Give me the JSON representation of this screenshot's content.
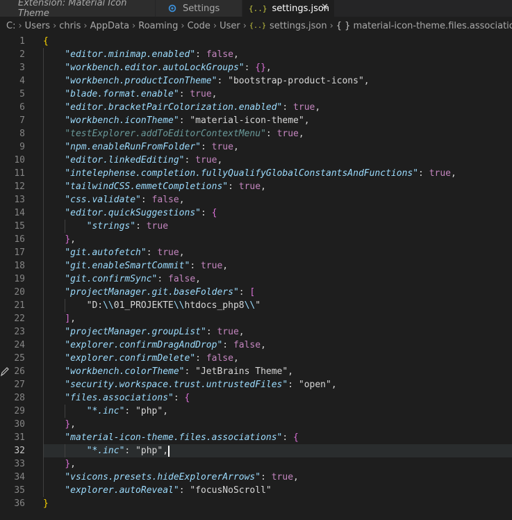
{
  "tabs": [
    {
      "label": "Extension: Material Icon Theme"
    },
    {
      "label": "Settings"
    },
    {
      "label": "settings.json"
    }
  ],
  "breadcrumb": {
    "segments": [
      "C:",
      "Users",
      "chris",
      "AppData",
      "Roaming",
      "Code",
      "User"
    ],
    "file": "settings.json",
    "object": "material-icon-theme.files.associations"
  },
  "icons": {
    "settings_tab": "gear-icon",
    "json_file": "json-braces-icon",
    "close": "close-icon",
    "edit": "pencil-icon"
  },
  "colors": {
    "key": "#9cdcfe",
    "boolean": "#c586c0",
    "bracket_level1": "#ffd700",
    "bracket_level2": "#da70d6",
    "json_icon": "#cbcb41"
  },
  "editor": {
    "current_line": 32,
    "lines": [
      {
        "n": "1",
        "t": "{"
      },
      {
        "n": "2",
        "t": "    \"editor.minimap.enabled\": false,"
      },
      {
        "n": "3",
        "t": "    \"workbench.editor.autoLockGroups\": {},"
      },
      {
        "n": "4",
        "t": "    \"workbench.productIconTheme\": \"bootstrap-product-icons\","
      },
      {
        "n": "5",
        "t": "    \"blade.format.enable\": true,"
      },
      {
        "n": "6",
        "t": "    \"editor.bracketPairColorization.enabled\": true,"
      },
      {
        "n": "7",
        "t": "    \"workbench.iconTheme\": \"material-icon-theme\","
      },
      {
        "n": "8",
        "t": "    \"testExplorer.addToEditorContextMenu\": true,"
      },
      {
        "n": "9",
        "t": "    \"npm.enableRunFromFolder\": true,"
      },
      {
        "n": "10",
        "t": "    \"editor.linkedEditing\": true,"
      },
      {
        "n": "11",
        "t": "    \"intelephense.completion.fullyQualifyGlobalConstantsAndFunctions\": true,"
      },
      {
        "n": "12",
        "t": "    \"tailwindCSS.emmetCompletions\": true,"
      },
      {
        "n": "13",
        "t": "    \"css.validate\": false,"
      },
      {
        "n": "14",
        "t": "    \"editor.quickSuggestions\": {"
      },
      {
        "n": "15",
        "t": "        \"strings\": true"
      },
      {
        "n": "16",
        "t": "    },"
      },
      {
        "n": "17",
        "t": "    \"git.autofetch\": true,"
      },
      {
        "n": "18",
        "t": "    \"git.enableSmartCommit\": true,"
      },
      {
        "n": "19",
        "t": "    \"git.confirmSync\": false,"
      },
      {
        "n": "20",
        "t": "    \"projectManager.git.baseFolders\": ["
      },
      {
        "n": "21",
        "t": "        \"D:\\\\01_PROJEKTE\\\\htdocs_php8\\\\\""
      },
      {
        "n": "22",
        "t": "    ],"
      },
      {
        "n": "23",
        "t": "    \"projectManager.groupList\": true,"
      },
      {
        "n": "24",
        "t": "    \"explorer.confirmDragAndDrop\": false,"
      },
      {
        "n": "25",
        "t": "    \"explorer.confirmDelete\": false,"
      },
      {
        "n": "26",
        "t": "    \"workbench.colorTheme\": \"JetBrains Theme\","
      },
      {
        "n": "27",
        "t": "    \"security.workspace.trust.untrustedFiles\": \"open\","
      },
      {
        "n": "28",
        "t": "    \"files.associations\": {"
      },
      {
        "n": "29",
        "t": "        \"*.inc\": \"php\","
      },
      {
        "n": "30",
        "t": "    },"
      },
      {
        "n": "31",
        "t": "    \"material-icon-theme.files.associations\": {"
      },
      {
        "n": "32",
        "t": "        \"*.inc\": \"php\","
      },
      {
        "n": "33",
        "t": "    },"
      },
      {
        "n": "34",
        "t": "    \"vsicons.presets.hideExplorerArrows\": true,"
      },
      {
        "n": "35",
        "t": "    \"explorer.autoReveal\": \"focusNoScroll\""
      },
      {
        "n": "36",
        "t": "}"
      }
    ]
  }
}
